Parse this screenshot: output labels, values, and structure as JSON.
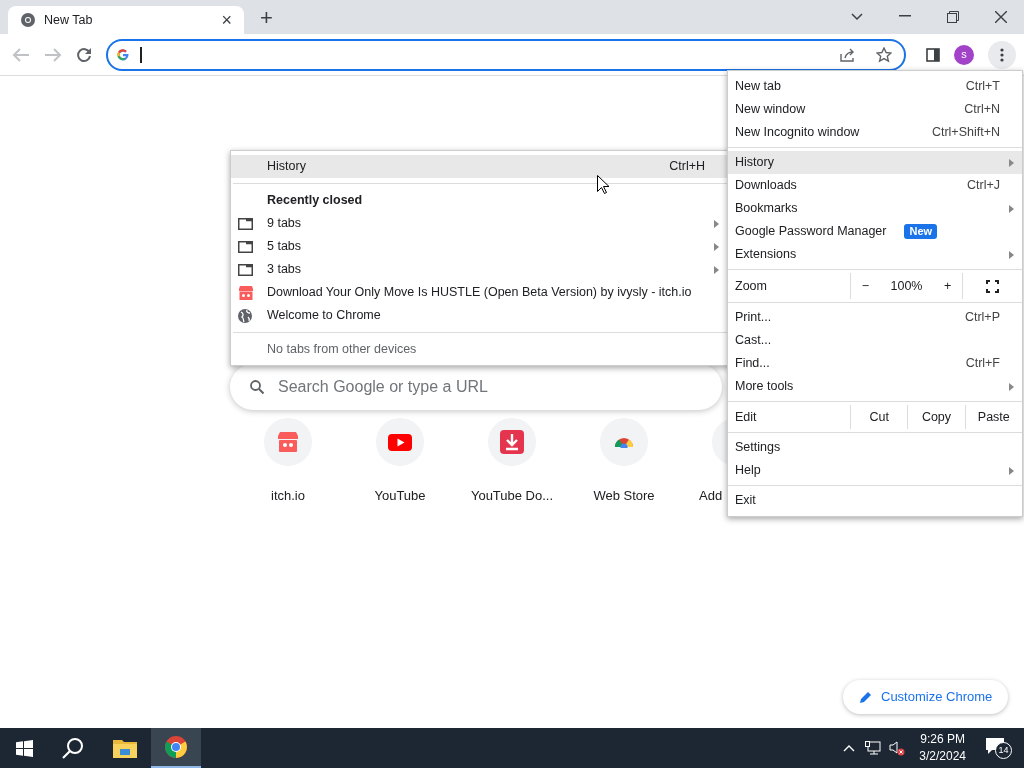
{
  "tab": {
    "title": "New Tab",
    "close": "×",
    "new_tab": "+"
  },
  "toolbar": {
    "avatar": "s"
  },
  "search_box": {
    "placeholder": "Search Google or type a URL"
  },
  "shortcuts": [
    {
      "kind": "itch",
      "label": "itch.io"
    },
    {
      "kind": "youtube",
      "label": "YouTube"
    },
    {
      "kind": "download",
      "label": "YouTube Do..."
    },
    {
      "kind": "webstore",
      "label": "Web Store"
    },
    {
      "kind": "add",
      "label": "Add"
    }
  ],
  "customize_button": {
    "label": "Customize Chrome"
  },
  "history_menu": {
    "items": [
      {
        "kind": "header",
        "label": "History",
        "shortcut": "Ctrl+H",
        "selected": true
      },
      {
        "kind": "separator"
      },
      {
        "kind": "section",
        "label": "Recently closed"
      },
      {
        "kind": "window",
        "label": "9 tabs",
        "submenu": true
      },
      {
        "kind": "window",
        "label": "5 tabs",
        "submenu": true
      },
      {
        "kind": "window",
        "label": "3 tabs",
        "submenu": true
      },
      {
        "kind": "store",
        "label": "Download Your Only Move Is HUSTLE (Open Beta Version) by ivysly - itch.io"
      },
      {
        "kind": "web",
        "label": "Welcome to Chrome"
      },
      {
        "kind": "separator"
      },
      {
        "kind": "note",
        "label": "No tabs from other devices"
      }
    ]
  },
  "main_menu": {
    "items": [
      {
        "kind": "item",
        "label": "New tab",
        "shortcut": "Ctrl+T",
        "selected": false
      },
      {
        "kind": "item",
        "label": "New window",
        "shortcut": "Ctrl+N",
        "selected": false
      },
      {
        "kind": "item",
        "label": "New Incognito window",
        "shortcut": "Ctrl+Shift+N",
        "selected": false
      },
      {
        "kind": "separator"
      },
      {
        "kind": "item",
        "label": "History",
        "submenu": true,
        "selected": true
      },
      {
        "kind": "item",
        "label": "Downloads",
        "shortcut": "Ctrl+J",
        "selected": false
      },
      {
        "kind": "item",
        "label": "Bookmarks",
        "submenu": true,
        "selected": false
      },
      {
        "kind": "item",
        "label": "Google Password Manager",
        "badge": "New",
        "selected": false
      },
      {
        "kind": "item",
        "label": "Extensions",
        "submenu": true,
        "selected": false
      },
      {
        "kind": "separator"
      },
      {
        "kind": "zoom",
        "label": "Zoom",
        "minus": "−",
        "value": "100%",
        "plus": "+"
      },
      {
        "kind": "separator"
      },
      {
        "kind": "item",
        "label": "Print...",
        "shortcut": "Ctrl+P",
        "selected": false
      },
      {
        "kind": "item",
        "label": "Cast...",
        "selected": false
      },
      {
        "kind": "item",
        "label": "Find...",
        "shortcut": "Ctrl+F",
        "selected": false
      },
      {
        "kind": "item",
        "label": "More tools",
        "submenu": true,
        "selected": false
      },
      {
        "kind": "separator"
      },
      {
        "kind": "edit",
        "label": "Edit",
        "buttons": [
          "Cut",
          "Copy",
          "Paste"
        ]
      },
      {
        "kind": "separator"
      },
      {
        "kind": "item",
        "label": "Settings",
        "selected": false
      },
      {
        "kind": "item",
        "label": "Help",
        "submenu": true,
        "selected": false
      },
      {
        "kind": "separator"
      },
      {
        "kind": "item",
        "label": "Exit",
        "selected": false
      }
    ]
  },
  "taskbar": {
    "time": "9:26 PM",
    "date": "3/2/2024",
    "notifications": "14"
  }
}
